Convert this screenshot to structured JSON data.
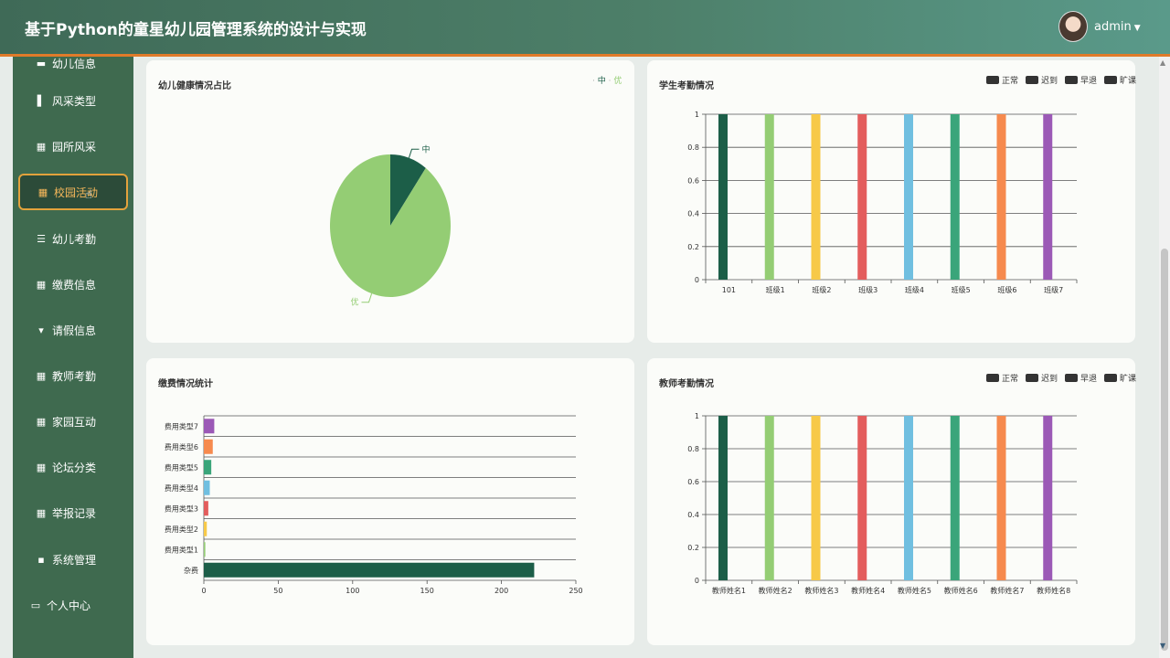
{
  "header": {
    "title": "基于Python的童星幼儿园管理系统的设计与实现",
    "user": "admin",
    "caret": "▼"
  },
  "sidebar": {
    "items": [
      {
        "label": "幼儿信息",
        "icon": "▬"
      },
      {
        "label": "风采类型",
        "icon": "▌"
      },
      {
        "label": "园所风采",
        "icon": "▦"
      },
      {
        "label": "校园活动",
        "icon": "▦"
      },
      {
        "label": "幼儿考勤",
        "icon": "☰"
      },
      {
        "label": "缴费信息",
        "icon": "▦"
      },
      {
        "label": "请假信息",
        "icon": "▾"
      },
      {
        "label": "教师考勤",
        "icon": "▦"
      },
      {
        "label": "家园互动",
        "icon": "▦"
      },
      {
        "label": "论坛分类",
        "icon": "▦"
      },
      {
        "label": "举报记录",
        "icon": "▦"
      },
      {
        "label": "系统管理",
        "icon": "▪"
      },
      {
        "label": "个人中心",
        "icon": "▭"
      }
    ],
    "active_index": 3,
    "cursor_icon": "☝"
  },
  "cards": {
    "health": {
      "title": "幼儿健康情况占比",
      "legend": [
        "中",
        "优"
      ]
    },
    "student_att": {
      "title": "学生考勤情况",
      "legend": [
        "正常",
        "迟到",
        "早退",
        "旷课"
      ]
    },
    "fee": {
      "title": "缴费情况统计"
    },
    "teacher_att": {
      "title": "教师考勤情况",
      "legend": [
        "正常",
        "迟到",
        "早退",
        "旷课"
      ]
    }
  },
  "chart_data": [
    {
      "type": "pie",
      "title": "幼儿健康情况占比",
      "slices": [
        {
          "name": "中",
          "value": 10
        },
        {
          "name": "优",
          "value": 90
        }
      ],
      "colors": [
        "#1c5e48",
        "#94cd74"
      ],
      "legend_position": "top-right"
    },
    {
      "type": "bar",
      "title": "学生考勤情况",
      "categories": [
        "101",
        "班级1",
        "班级2",
        "班级3",
        "班级4",
        "班级5",
        "班级6",
        "班级7"
      ],
      "values": [
        1,
        1,
        1,
        1,
        1,
        1,
        1,
        1
      ],
      "colors": [
        "#1c5e48",
        "#94cd74",
        "#f7c948",
        "#e35d5d",
        "#70bfe0",
        "#3aa57a",
        "#f68a4e",
        "#9b59b6"
      ],
      "ylim": [
        0,
        1
      ],
      "yticks": [
        "0",
        "0.2",
        "0.4",
        "0.6",
        "0.8",
        "1"
      ],
      "grid": true,
      "legend_position": "top-right"
    },
    {
      "type": "bar",
      "orientation": "horizontal",
      "title": "缴费情况统计",
      "categories": [
        "杂费",
        "费用类型1",
        "费用类型2",
        "费用类型3",
        "费用类型4",
        "费用类型5",
        "费用类型6",
        "费用类型7"
      ],
      "values": [
        222,
        1,
        2,
        3,
        4,
        5,
        6,
        7
      ],
      "colors": [
        "#1c5e48",
        "#94cd74",
        "#f7c948",
        "#e35d5d",
        "#70bfe0",
        "#3aa57a",
        "#f68a4e",
        "#9b59b6"
      ],
      "xlim": [
        0,
        250
      ],
      "xticks": [
        "0",
        "50",
        "100",
        "150",
        "200",
        "250"
      ],
      "grid": true
    },
    {
      "type": "bar",
      "title": "教师考勤情况",
      "categories": [
        "教师姓名1",
        "教师姓名2",
        "教师姓名3",
        "教师姓名4",
        "教师姓名5",
        "教师姓名6",
        "教师姓名7",
        "教师姓名8"
      ],
      "values": [
        1,
        1,
        1,
        1,
        1,
        1,
        1,
        1
      ],
      "colors": [
        "#1c5e48",
        "#94cd74",
        "#f7c948",
        "#e35d5d",
        "#70bfe0",
        "#3aa57a",
        "#f68a4e",
        "#9b59b6"
      ],
      "ylim": [
        0,
        1
      ],
      "yticks": [
        "0",
        "0.2",
        "0.4",
        "0.6",
        "0.8",
        "1"
      ],
      "grid": true,
      "legend_position": "top-right"
    }
  ]
}
